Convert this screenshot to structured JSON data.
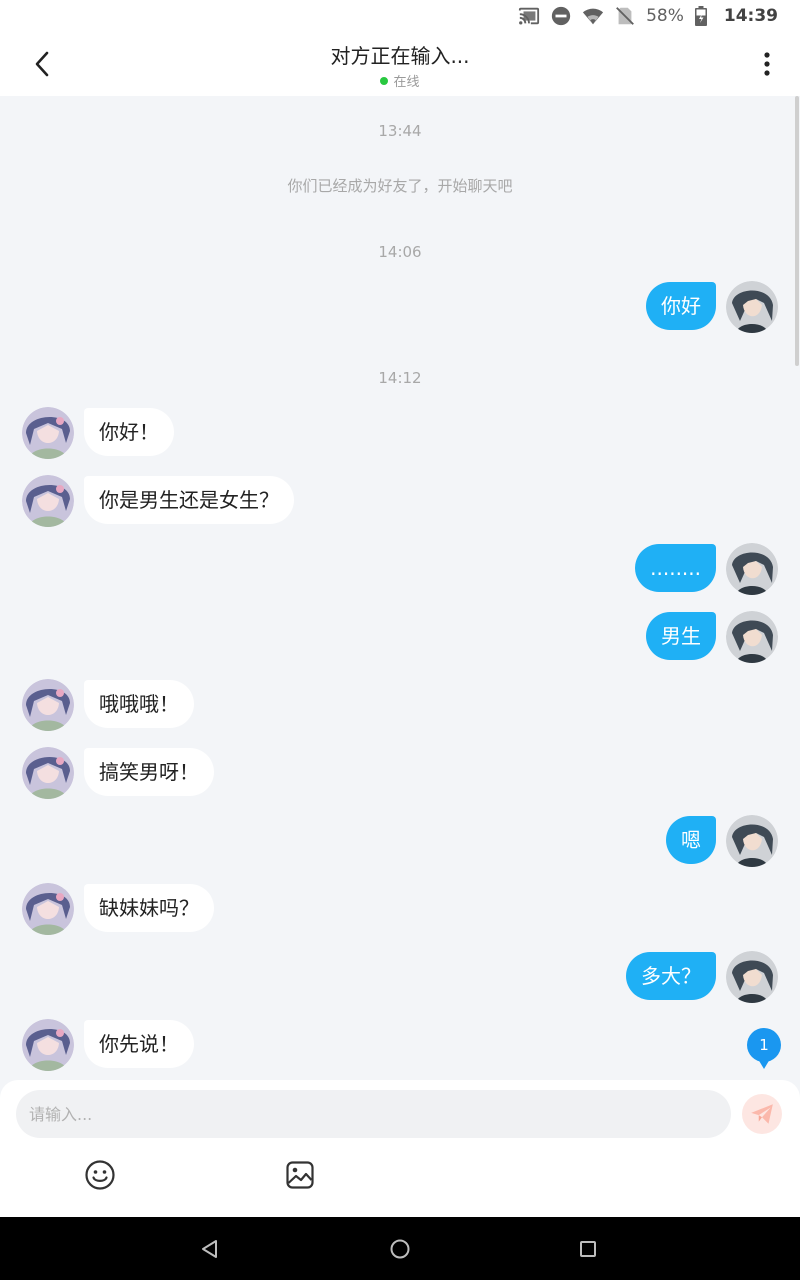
{
  "status_bar": {
    "icons": [
      "cast-icon",
      "dnd-icon",
      "wifi-icon",
      "no-sim-icon",
      "battery-icon"
    ],
    "battery": "58%",
    "time": "14:39"
  },
  "header": {
    "title": "对方正在输入...",
    "status": "在线",
    "back_icon": "chevron-left-icon",
    "more_icon": "more-vertical-icon"
  },
  "chat": {
    "items": [
      {
        "type": "time",
        "text": "13:44"
      },
      {
        "type": "system",
        "text": "你们已经成为好友了，开始聊天吧"
      },
      {
        "type": "time",
        "text": "14:06"
      },
      {
        "type": "msg",
        "side": "right",
        "text": "你好"
      },
      {
        "type": "time",
        "text": "14:12"
      },
      {
        "type": "msg",
        "side": "left",
        "text": "你好！"
      },
      {
        "type": "msg",
        "side": "left",
        "text": "你是男生还是女生？"
      },
      {
        "type": "msg",
        "side": "right",
        "text": "........"
      },
      {
        "type": "msg",
        "side": "right",
        "text": "男生"
      },
      {
        "type": "msg",
        "side": "left",
        "text": "哦哦哦！"
      },
      {
        "type": "msg",
        "side": "left",
        "text": "搞笑男呀！"
      },
      {
        "type": "msg",
        "side": "right",
        "text": "嗯"
      },
      {
        "type": "msg",
        "side": "left",
        "text": "缺妹妹吗？"
      },
      {
        "type": "msg",
        "side": "right",
        "text": "多大？"
      },
      {
        "type": "msg",
        "side": "left",
        "text": "你先说！"
      }
    ],
    "unread_count": "1"
  },
  "composer": {
    "placeholder": "请输入...",
    "value": "",
    "send_icon": "send-icon",
    "emoji_icon": "emoji-icon",
    "image_icon": "image-icon"
  },
  "colors": {
    "accent": "#1fb0f5",
    "background": "#f3f5f8",
    "online": "#28c840",
    "badge": "#1a97f0"
  },
  "nav": {
    "icons": [
      "back-triangle-icon",
      "home-circle-icon",
      "recents-square-icon"
    ]
  }
}
